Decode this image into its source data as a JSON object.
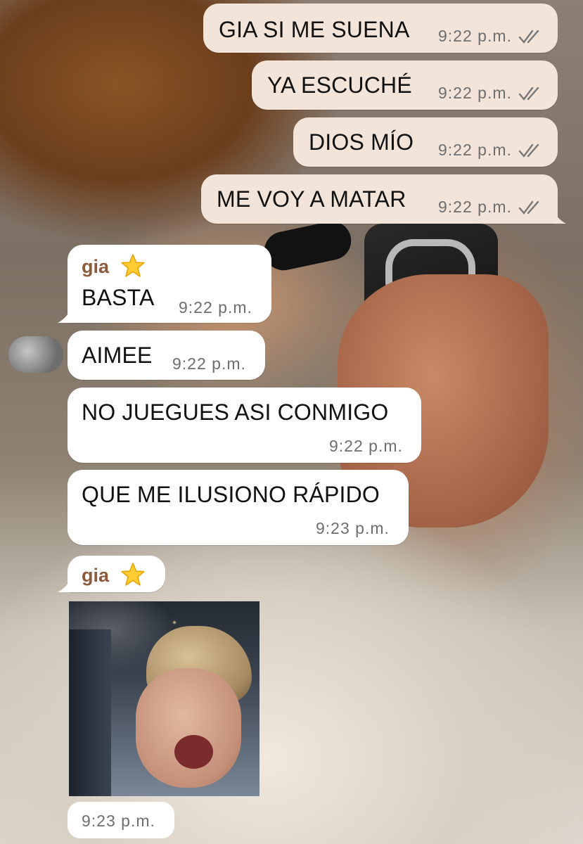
{
  "outgoing": [
    {
      "text": "GIA SI ME SUENA",
      "time": "9:22 p.m."
    },
    {
      "text": "YA ESCUCHÉ",
      "time": "9:22 p.m."
    },
    {
      "text": "DIOS MÍO",
      "time": "9:22 p.m."
    },
    {
      "text": "ME VOY A MATAR",
      "time": "9:22 p.m."
    }
  ],
  "incoming": [
    {
      "sender": "gia",
      "text": "BASTA",
      "time": "9:22 p.m."
    },
    {
      "text": "AIMEE",
      "time": "9:22 p.m."
    },
    {
      "text": "NO JUEGUES ASI CONMIGO",
      "time": "9:22 p.m."
    },
    {
      "text": "QUE ME ILUSIONO RÁPIDO",
      "time": "9:23 p.m."
    }
  ],
  "media_message": {
    "sender": "gia",
    "time": "9:23 p.m."
  },
  "colors": {
    "outgoing_bubble": "#f2e4d9",
    "incoming_bubble": "#ffffff",
    "sender_name": "#8c5a3c",
    "timestamp": "#6e6e6e"
  }
}
